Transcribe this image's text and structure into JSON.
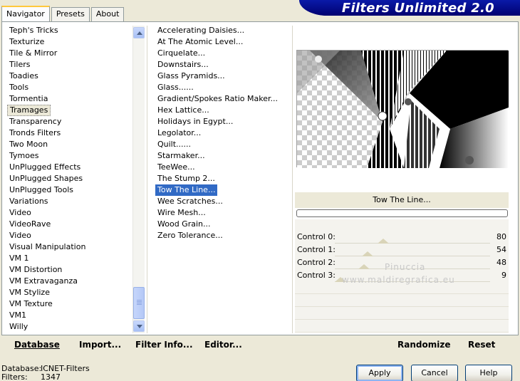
{
  "tabs": [
    {
      "label": "Navigator"
    },
    {
      "label": "Presets"
    },
    {
      "label": "About"
    }
  ],
  "app_title": "Filters Unlimited 2.0",
  "categories": [
    "Teph's Tricks",
    "Texturize",
    "Tile & Mirror",
    "Tilers",
    "Toadies",
    "Tools",
    "Tormentia",
    "Tramages",
    "Transparency",
    "Tronds Filters",
    "Two Moon",
    "Tymoes",
    "UnPlugged Effects",
    "UnPlugged Shapes",
    "UnPlugged Tools",
    "Variations",
    "Video",
    "VideoRave",
    "Video",
    "Visual Manipulation",
    "VM 1",
    "VM Distortion",
    "VM Extravaganza",
    "VM Stylize",
    "VM Texture",
    "VM1",
    "Willy"
  ],
  "selected_category": "Tramages",
  "filters": [
    "Accelerating Daisies...",
    "At The Atomic Level...",
    "Cirquelate...",
    "Downstairs...",
    "Glass Pyramids...",
    "Glass......",
    "Gradient/Spokes Ratio Maker...",
    "Hex Lattice...",
    "Holidays in Egypt...",
    "Legolator...",
    "Quilt......",
    "Starmaker...",
    "TeeWee...",
    "The Stump 2...",
    "Tow The Line...",
    "Wee Scratches...",
    "Wire Mesh...",
    "Wood Grain...",
    "Zero Tolerance..."
  ],
  "selected_filter": "Tow The Line...",
  "filter_name": "Tow The Line...",
  "controls": [
    {
      "label": "Control 0:",
      "value": "80",
      "level": 80
    },
    {
      "label": "Control 1:",
      "value": "54",
      "level": 54
    },
    {
      "label": "Control 2:",
      "value": "48",
      "level": 48
    },
    {
      "label": "Control 3:",
      "value": "9",
      "level": 9
    }
  ],
  "watermark": {
    "line1": "Pinuccia",
    "line2": "www.maldiregrafica.eu"
  },
  "toolbar": {
    "database": "Database",
    "import": "Import...",
    "filter_info": "Filter Info...",
    "editor": "Editor...",
    "randomize": "Randomize",
    "reset": "Reset"
  },
  "status": {
    "database_label": "Database:",
    "database_value": "ICNET-Filters",
    "filters_label": "Filters:",
    "filters_value": "1347"
  },
  "buttons": {
    "apply": "Apply",
    "cancel": "Cancel",
    "help": "Help"
  }
}
